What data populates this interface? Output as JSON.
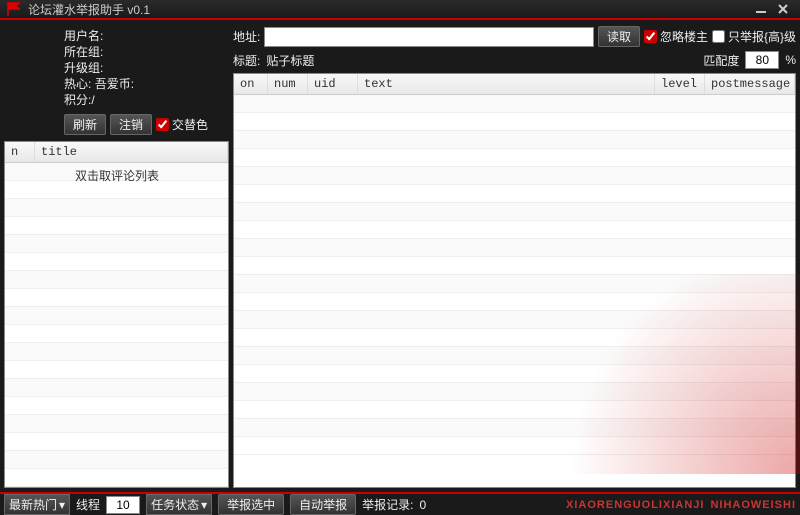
{
  "title": "论坛灌水举报助手  v0.1",
  "userinfo": {
    "username_label": "用户名:",
    "group_label": "所在组:",
    "upgrade_label": "升级组:",
    "hot_label": "热心:",
    "coin_label": "吾爱币:",
    "score_label": "积分:",
    "score_sep": "/"
  },
  "buttons": {
    "refresh": "刷新",
    "logout": "注销",
    "alt_color": "交替色"
  },
  "left_grid": {
    "cols": [
      "n",
      "title"
    ],
    "hint": "双击取评论列表"
  },
  "addr": {
    "label": "地址:",
    "value": "",
    "read": "读取",
    "ignore_op": "忽略楼主",
    "only_high": "只举报{高}级"
  },
  "subject": {
    "label": "标题:",
    "value": "贴子标题",
    "match_label": "匹配度",
    "match_value": "80",
    "pct": "%"
  },
  "right_grid": {
    "cols": [
      "on",
      "num",
      "uid",
      "text",
      "level",
      "postmessage"
    ]
  },
  "footer": {
    "hot_dropdown": "最新热门",
    "thread_label": "线程",
    "thread_value": "10",
    "task_label": "任务状态",
    "report_sel": "举报选中",
    "auto_report": "自动举报",
    "record_label": "举报记录:",
    "record_value": "0",
    "credit1": "XIAORENGUOLIXIANJI",
    "credit2": "NIHAOWEISHI"
  }
}
